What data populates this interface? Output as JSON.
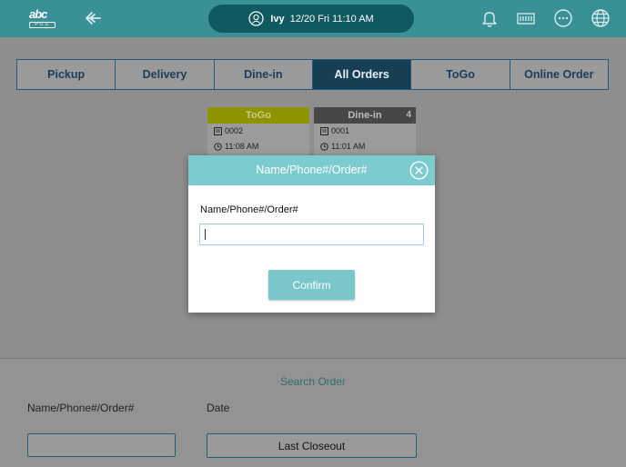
{
  "header": {
    "logo_top": "abc",
    "logo_bottom": "POS",
    "user_name": "Ivy",
    "datetime": "12/20 Fri 11:10 AM",
    "icons": [
      "back-icon",
      "bell-icon",
      "cash-drawer-icon",
      "more-icon",
      "globe-icon"
    ]
  },
  "tabs": [
    {
      "label": "Pickup",
      "active": false
    },
    {
      "label": "Delivery",
      "active": false
    },
    {
      "label": "Dine-in",
      "active": false
    },
    {
      "label": "All Orders",
      "active": true
    },
    {
      "label": "ToGo",
      "active": false
    },
    {
      "label": "Online Order",
      "active": false
    }
  ],
  "orders": [
    {
      "type": "ToGo",
      "number": "0002",
      "time": "11:08 AM",
      "badge": "",
      "color": "#9aa300"
    },
    {
      "type": "Dine-in",
      "number": "0001",
      "time": "11:01 AM",
      "badge": "4",
      "color": "#4a4a4a"
    }
  ],
  "search": {
    "title": "Search Order",
    "name_label": "Name/Phone#/Order#",
    "date_label": "Date",
    "name_value": "",
    "date_value": "Last Closeout"
  },
  "modal": {
    "title": "Name/Phone#/Order#",
    "field_label": "Name/Phone#/Order#",
    "field_value": "",
    "confirm_label": "Confirm"
  },
  "colors": {
    "header": "#3a9097",
    "pill": "#0f5961",
    "modal_accent": "#7ccbcf",
    "active_tab": "#163e55"
  }
}
